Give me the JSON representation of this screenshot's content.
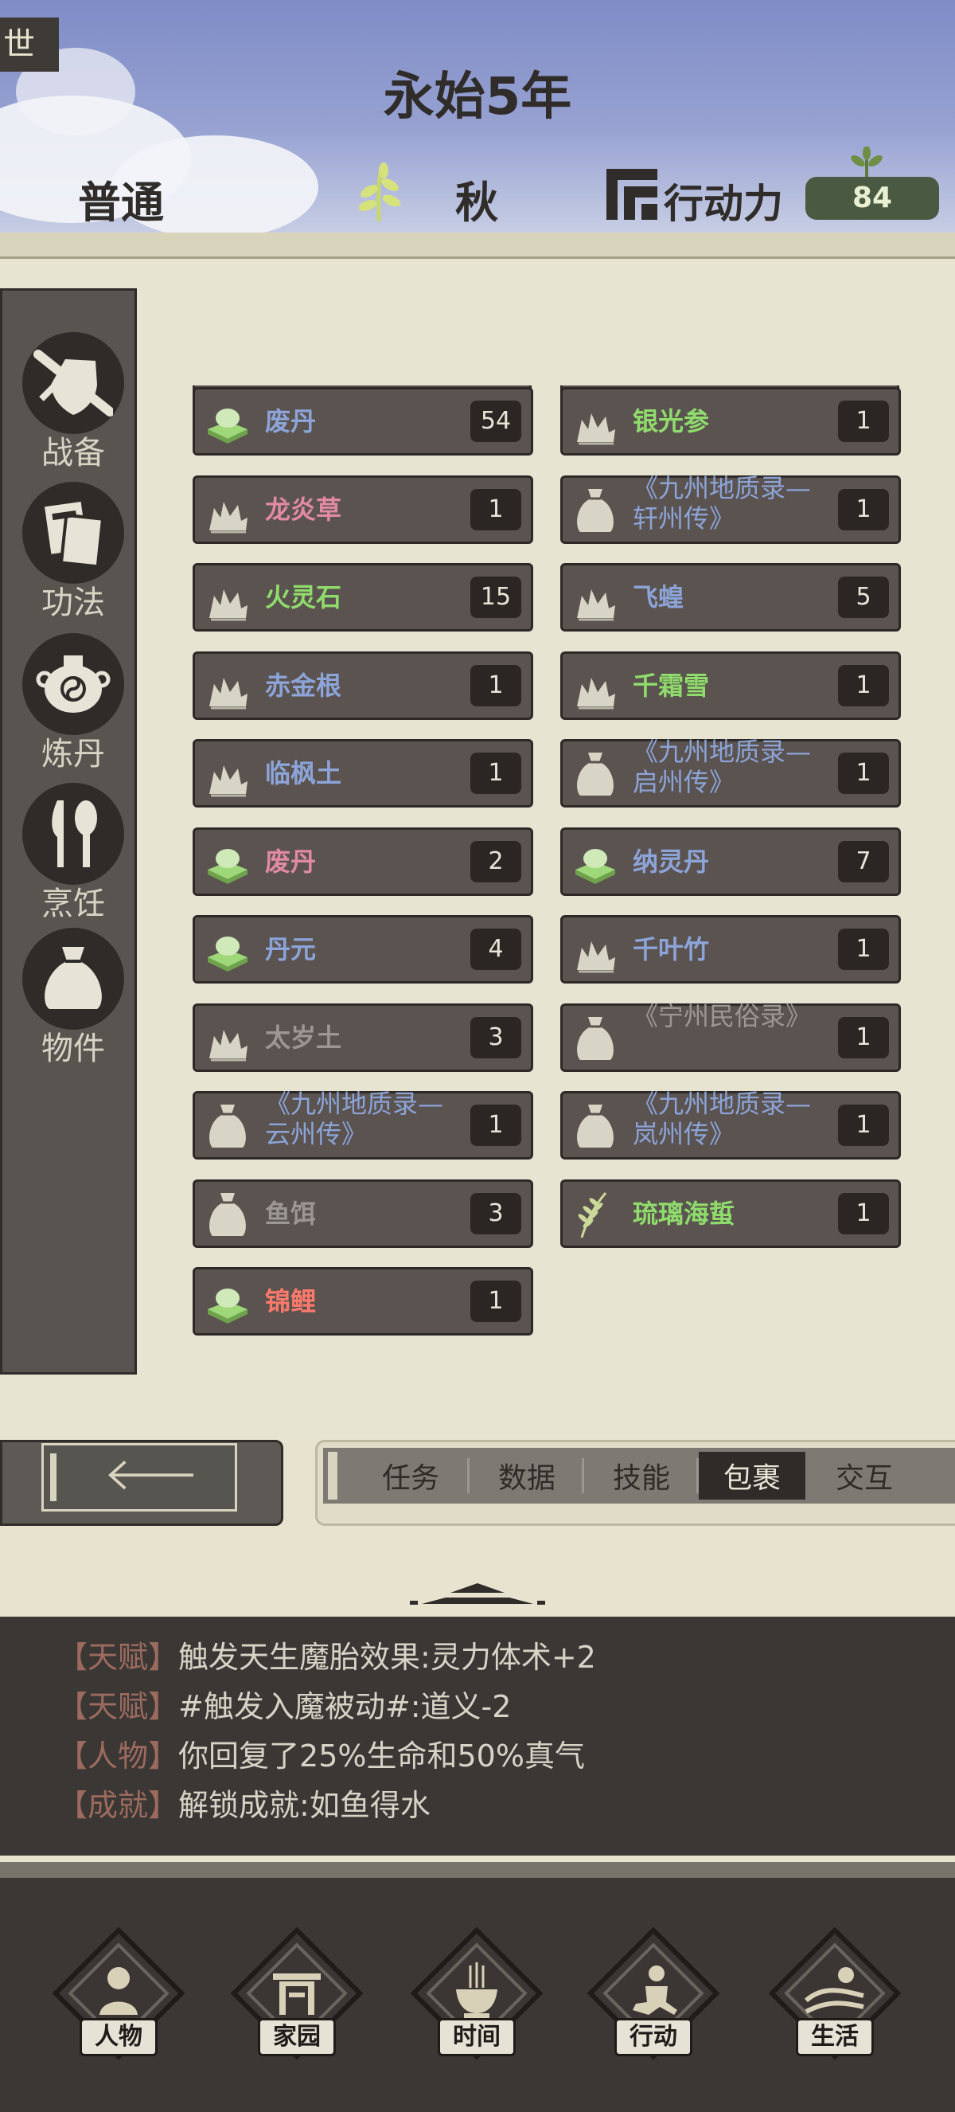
{
  "header": {
    "corner_tab": "世",
    "era": "永始5年",
    "difficulty": "普通",
    "season": "秋",
    "action_label": "行动力",
    "action_points": "84"
  },
  "sidebar": {
    "items": [
      {
        "label": "战备",
        "icon": "sword-shield-icon"
      },
      {
        "label": "功法",
        "icon": "scroll-book-icon"
      },
      {
        "label": "炼丹",
        "icon": "cauldron-icon"
      },
      {
        "label": "烹饪",
        "icon": "knife-spoon-icon"
      },
      {
        "label": "物件",
        "icon": "bag-icon"
      }
    ]
  },
  "inventory": {
    "left": [
      {
        "name": "废丹",
        "qty": "54",
        "color": "pink-hidden",
        "icon": "pill-icon",
        "cls": "c-blue"
      },
      {
        "name": "龙炎草",
        "qty": "1",
        "icon": "herb-icon",
        "cls": "c-pink"
      },
      {
        "name": "火灵石",
        "qty": "15",
        "icon": "herb-icon",
        "cls": "c-green"
      },
      {
        "name": "赤金根",
        "qty": "1",
        "icon": "herb-icon",
        "cls": "c-blue"
      },
      {
        "name": "临枫土",
        "qty": "1",
        "icon": "herb-icon",
        "cls": "c-blue"
      },
      {
        "name": "废丹",
        "qty": "2",
        "icon": "pill-icon",
        "cls": "c-pink"
      },
      {
        "name": "丹元",
        "qty": "4",
        "icon": "pill-icon",
        "cls": "c-blue"
      },
      {
        "name": "太岁土",
        "qty": "3",
        "icon": "herb-icon",
        "cls": "c-gray"
      },
      {
        "name": "《九州地质录—云州传》",
        "qty": "1",
        "icon": "bag-icon",
        "cls": "c-blue",
        "two": true
      },
      {
        "name": "鱼饵",
        "qty": "3",
        "icon": "bag-icon",
        "cls": "c-gray"
      },
      {
        "name": "锦鲤",
        "qty": "1",
        "icon": "pill-icon",
        "cls": "c-red"
      }
    ],
    "right": [
      {
        "name": "银光参",
        "qty": "1",
        "icon": "herb-icon",
        "cls": "c-green"
      },
      {
        "name": "《九州地质录—轩州传》",
        "qty": "1",
        "icon": "bag-icon",
        "cls": "c-blue",
        "two": true
      },
      {
        "name": "飞蝗",
        "qty": "5",
        "icon": "herb-icon",
        "cls": "c-blue"
      },
      {
        "name": "千霜雪",
        "qty": "1",
        "icon": "herb-icon",
        "cls": "c-green"
      },
      {
        "name": "《九州地质录—启州传》",
        "qty": "1",
        "icon": "bag-icon",
        "cls": "c-blue",
        "two": true
      },
      {
        "name": "纳灵丹",
        "qty": "7",
        "icon": "pill-icon",
        "cls": "c-blue"
      },
      {
        "name": "千叶竹",
        "qty": "1",
        "icon": "herb-icon",
        "cls": "c-blue"
      },
      {
        "name": "《宁州民俗录》",
        "qty": "1",
        "icon": "bag-icon",
        "cls": "c-gray",
        "two": true
      },
      {
        "name": "《九州地质录—岚州传》",
        "qty": "1",
        "icon": "bag-icon",
        "cls": "c-blue",
        "two": true
      },
      {
        "name": "琉璃海蜇",
        "qty": "1",
        "icon": "grass-icon",
        "cls": "c-green"
      }
    ]
  },
  "tabs": [
    "任务",
    "数据",
    "技能",
    "包裹",
    "交互"
  ],
  "active_tab": "包裹",
  "log": [
    {
      "tag": "【天赋】",
      "text": "触发天生魔胎效果:灵力体术+2"
    },
    {
      "tag": "【天赋】",
      "text": "#触发入魔被动#:道义-2"
    },
    {
      "tag": "【人物】",
      "text": "你回复了25%生命和50%真气"
    },
    {
      "tag": "【成就】",
      "text": "解锁成就:如鱼得水"
    }
  ],
  "nav": [
    "人物",
    "家园",
    "时间",
    "行动",
    "生活"
  ]
}
